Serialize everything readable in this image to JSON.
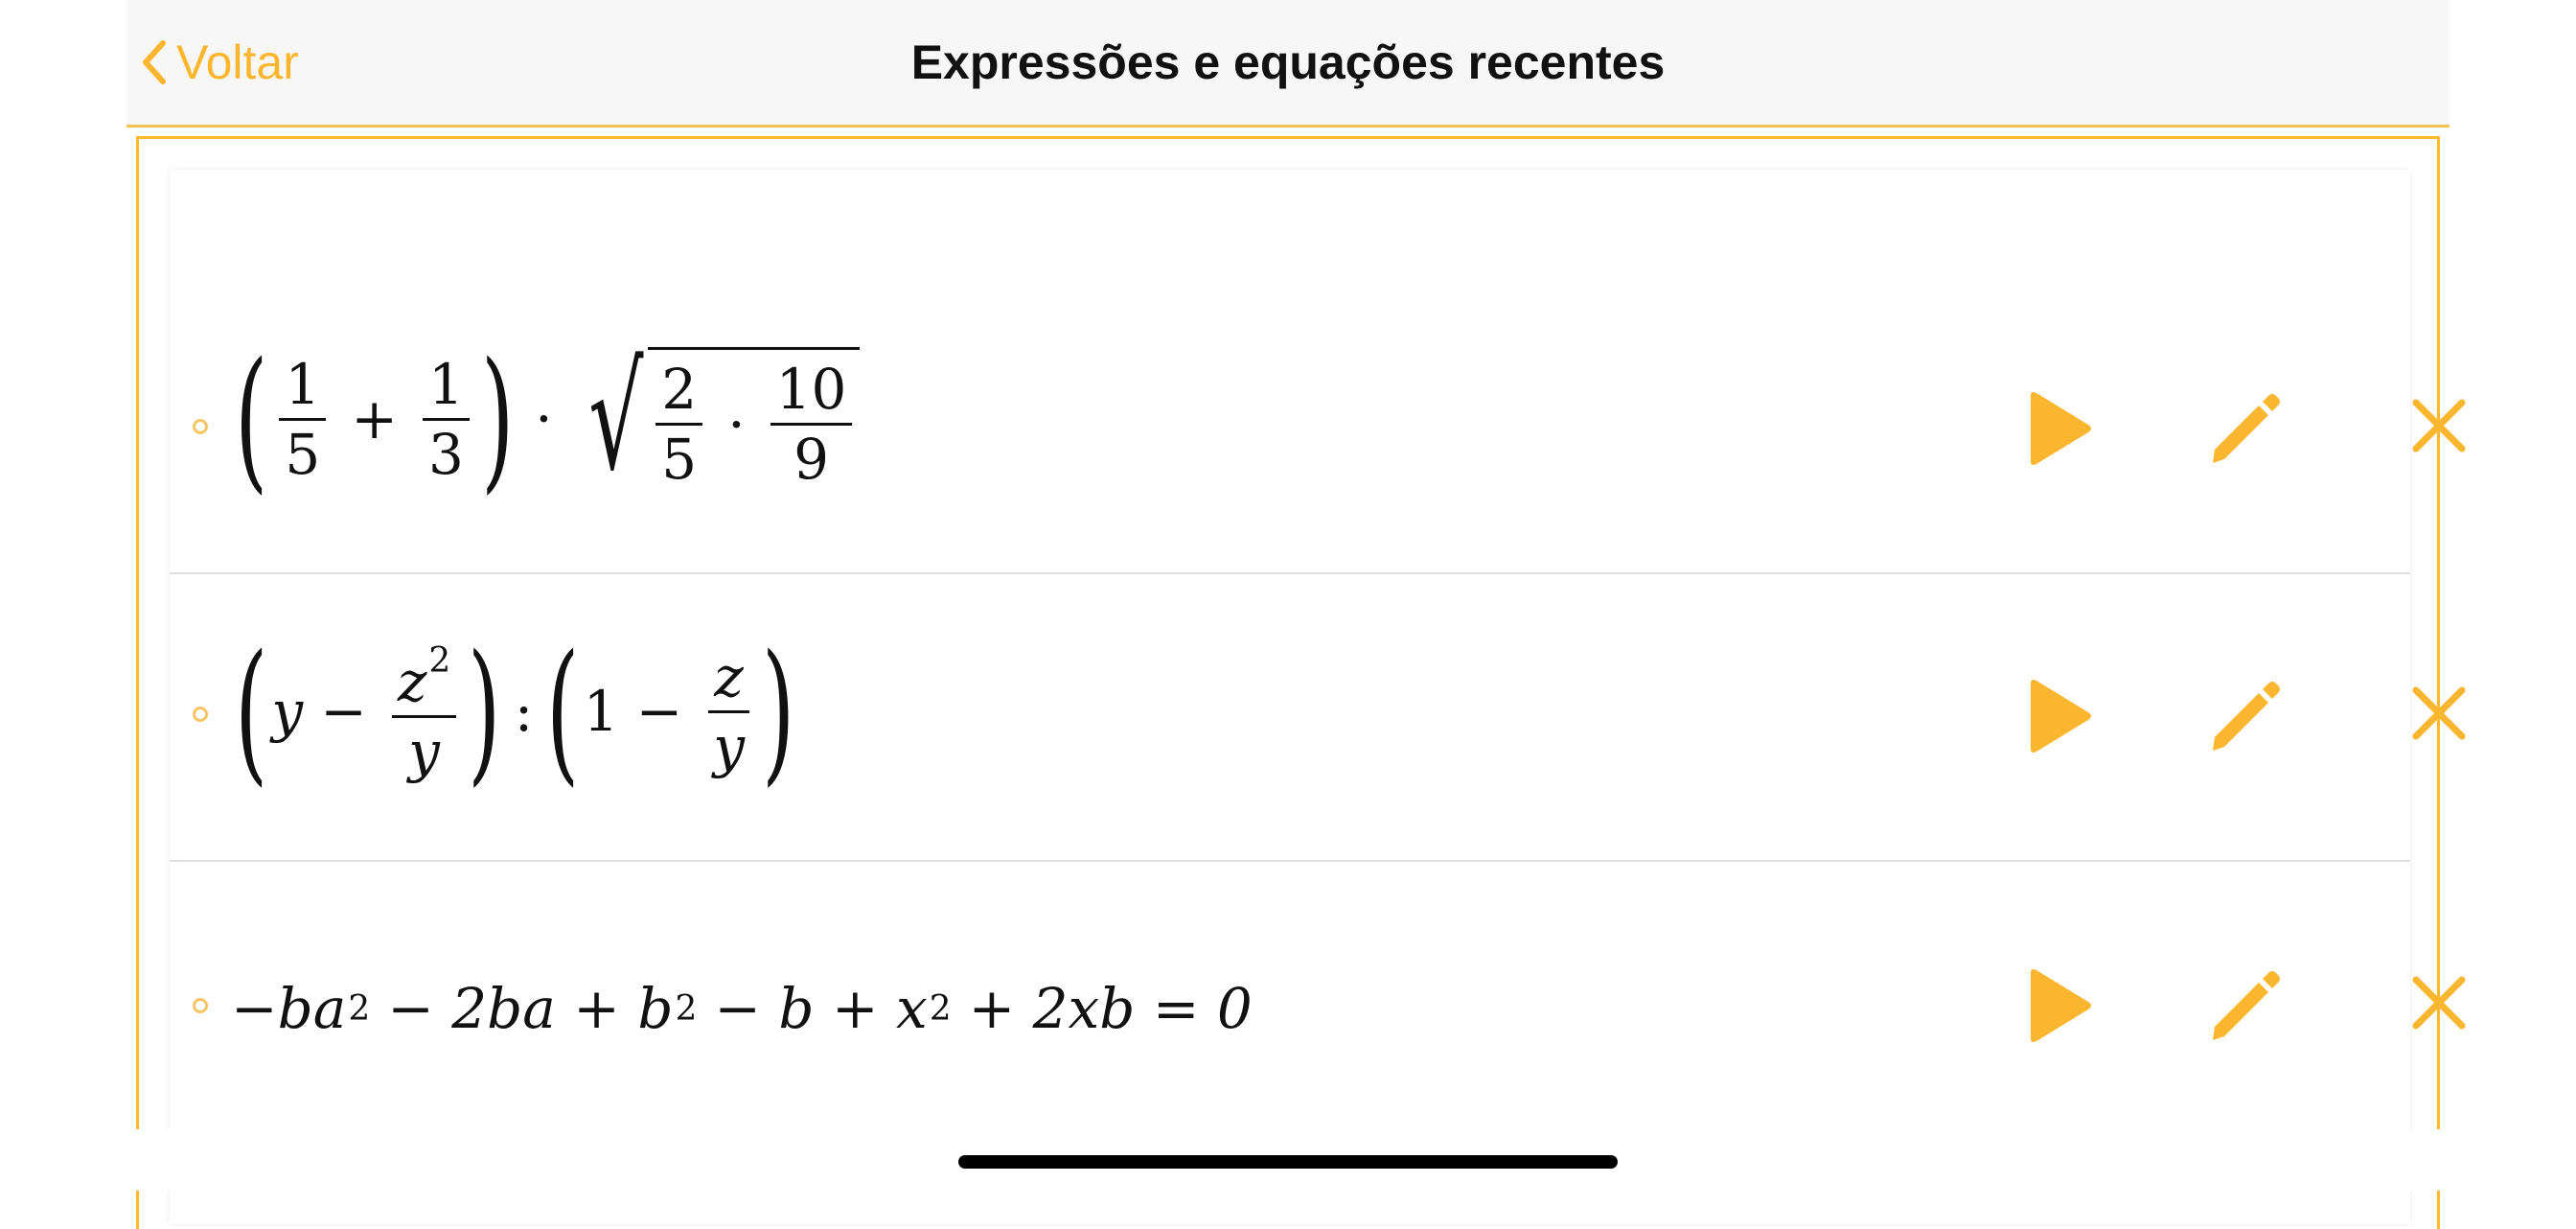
{
  "nav": {
    "back_label": "Voltar",
    "title": "Expressões e equações recentes"
  },
  "colors": {
    "accent": "#fbb630",
    "frame": "#f9b82e",
    "divider": "#dedede"
  },
  "rows": [
    {
      "kind": "expression",
      "latex": "\\left(\\frac{1}{5}+\\frac{1}{3}\\right)\\cdot\\sqrt{\\frac{2}{5}\\cdot\\frac{10}{9}}",
      "tokens": {
        "a_num": "1",
        "a_den": "5",
        "plus": "+",
        "b_num": "1",
        "b_den": "3",
        "dot": "·",
        "c_num": "2",
        "c_den": "5",
        "d_num": "10",
        "d_den": "9"
      },
      "actions": [
        "play-icon",
        "pencil-icon",
        "close-icon"
      ]
    },
    {
      "kind": "expression",
      "latex": "\\left(y-\\frac{z^2}{y}\\right):\\left(1-\\frac{z}{y}\\right)",
      "tokens": {
        "y": "y",
        "minus": "−",
        "z": "z",
        "exp": "2",
        "den": "y",
        "colon": ":",
        "one": "1",
        "z2": "z",
        "den2": "y"
      },
      "actions": [
        "play-icon",
        "pencil-icon",
        "close-icon"
      ]
    },
    {
      "kind": "equation",
      "latex": "-ba^2-2ba+b^2-b+x^2+2xb=0",
      "tokens": {
        "t1": "−ba",
        "e1": "2",
        "t2": "− 2ba + b",
        "e2": "2",
        "t3": "− b + x",
        "e3": "2",
        "t4": "+ 2xb = 0"
      },
      "actions": [
        "play-icon",
        "pencil-icon",
        "close-icon"
      ]
    }
  ]
}
